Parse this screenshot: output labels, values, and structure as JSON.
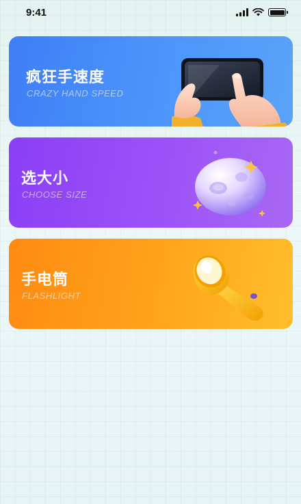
{
  "status_bar": {
    "time": "9:41"
  },
  "cards": [
    {
      "title": "疯狂手速度",
      "subtitle": "CRAZY HAND SPEED",
      "icon": "hands-phone-icon",
      "color_start": "#3f7ef6",
      "color_end": "#5aa3f7"
    },
    {
      "title": "选大小",
      "subtitle": "CHOOSE SIZE",
      "icon": "planet-icon",
      "color_start": "#8a3ff5",
      "color_end": "#a868f3"
    },
    {
      "title": "手电筒",
      "subtitle": "FLASHLIGHT",
      "icon": "flashlight-icon",
      "color_start": "#ff8a12",
      "color_end": "#ffbe2c"
    }
  ]
}
